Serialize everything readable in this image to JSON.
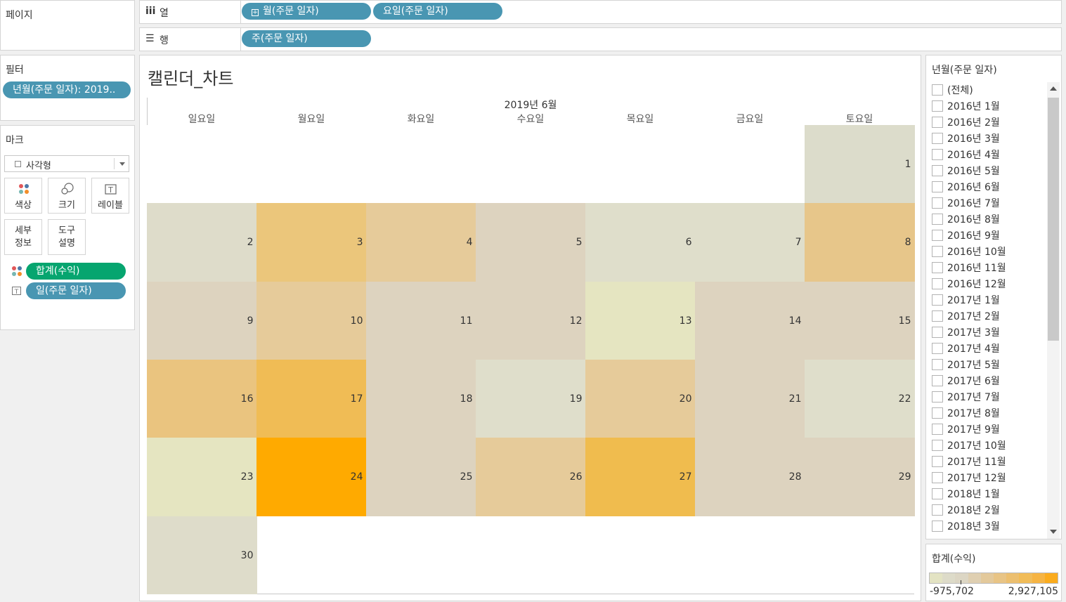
{
  "pages_panel": {
    "title": "페이지"
  },
  "columns_shelf": {
    "label": "열",
    "pills": [
      "월(주문 일자)",
      "요일(주문 일자)"
    ]
  },
  "rows_shelf": {
    "label": "행",
    "pills": [
      "주(주문 일자)"
    ]
  },
  "filters_panel": {
    "title": "필터",
    "pill": "년월(주문 일자): 2019.."
  },
  "marks_panel": {
    "title": "마크",
    "mark_type": "사각형",
    "buttons": {
      "color": "색상",
      "size": "크기",
      "label": "레이블",
      "detail": "세부\n정보",
      "tooltip": "도구\n설명"
    },
    "color_pill": "합계(수익)",
    "label_pill": "일(주문 일자)"
  },
  "chart": {
    "sheet_title": "캘린더_차트",
    "month_header": "2019년 6월",
    "weekdays": [
      "일요일",
      "월요일",
      "화요일",
      "수요일",
      "목요일",
      "금요일",
      "토요일"
    ]
  },
  "chart_data": {
    "type": "heatmap",
    "title": "캘린더_차트",
    "month": "2019년 6월",
    "columns": [
      "일요일",
      "월요일",
      "화요일",
      "수요일",
      "목요일",
      "금요일",
      "토요일"
    ],
    "cells": [
      {
        "day": 1,
        "week": 0,
        "weekday": 6,
        "color": "#dcdccb"
      },
      {
        "day": 2,
        "week": 1,
        "weekday": 0,
        "color": "#dedcca"
      },
      {
        "day": 3,
        "week": 1,
        "weekday": 1,
        "color": "#ebc67b"
      },
      {
        "day": 4,
        "week": 1,
        "weekday": 2,
        "color": "#e6cb9a"
      },
      {
        "day": 5,
        "week": 1,
        "weekday": 3,
        "color": "#ddd3bf"
      },
      {
        "day": 6,
        "week": 1,
        "weekday": 4,
        "color": "#dfdecb"
      },
      {
        "day": 7,
        "week": 1,
        "weekday": 5,
        "color": "#dfdecb"
      },
      {
        "day": 8,
        "week": 1,
        "weekday": 6,
        "color": "#e7c68a"
      },
      {
        "day": 9,
        "week": 2,
        "weekday": 0,
        "color": "#ddd3bf"
      },
      {
        "day": 10,
        "week": 2,
        "weekday": 1,
        "color": "#e6cb9a"
      },
      {
        "day": 11,
        "week": 2,
        "weekday": 2,
        "color": "#ddd3bf"
      },
      {
        "day": 12,
        "week": 2,
        "weekday": 3,
        "color": "#ddd3bf"
      },
      {
        "day": 13,
        "week": 2,
        "weekday": 4,
        "color": "#e5e5c1"
      },
      {
        "day": 14,
        "week": 2,
        "weekday": 5,
        "color": "#ddd3bf"
      },
      {
        "day": 15,
        "week": 2,
        "weekday": 6,
        "color": "#ddd3bf"
      },
      {
        "day": 16,
        "week": 3,
        "weekday": 0,
        "color": "#eac47f"
      },
      {
        "day": 17,
        "week": 3,
        "weekday": 1,
        "color": "#f0bc55"
      },
      {
        "day": 18,
        "week": 3,
        "weekday": 2,
        "color": "#ddd3bf"
      },
      {
        "day": 19,
        "week": 3,
        "weekday": 3,
        "color": "#dfdecb"
      },
      {
        "day": 20,
        "week": 3,
        "weekday": 4,
        "color": "#e6cb9a"
      },
      {
        "day": 21,
        "week": 3,
        "weekday": 5,
        "color": "#ddd3bf"
      },
      {
        "day": 22,
        "week": 3,
        "weekday": 6,
        "color": "#dfdecb"
      },
      {
        "day": 23,
        "week": 4,
        "weekday": 0,
        "color": "#e5e5c1"
      },
      {
        "day": 24,
        "week": 4,
        "weekday": 1,
        "color": "#ffaa00"
      },
      {
        "day": 25,
        "week": 4,
        "weekday": 2,
        "color": "#ddd3bf"
      },
      {
        "day": 26,
        "week": 4,
        "weekday": 3,
        "color": "#e6cb9a"
      },
      {
        "day": 27,
        "week": 4,
        "weekday": 4,
        "color": "#f0bc4e"
      },
      {
        "day": 28,
        "week": 4,
        "weekday": 5,
        "color": "#ddd3bf"
      },
      {
        "day": 29,
        "week": 4,
        "weekday": 6,
        "color": "#ddd3bf"
      },
      {
        "day": 30,
        "week": 5,
        "weekday": 0,
        "color": "#dedcca"
      }
    ]
  },
  "filter_list": {
    "title": "년월(주문 일자)",
    "items": [
      "(전체)",
      "2016년 1월",
      "2016년 2월",
      "2016년 3월",
      "2016년 4월",
      "2016년 5월",
      "2016년 6월",
      "2016년 7월",
      "2016년 8월",
      "2016년 9월",
      "2016년 10월",
      "2016년 11월",
      "2016년 12월",
      "2017년 1월",
      "2017년 2월",
      "2017년 3월",
      "2017년 4월",
      "2017년 5월",
      "2017년 6월",
      "2017년 7월",
      "2017년 8월",
      "2017년 9월",
      "2017년 10월",
      "2017년 11월",
      "2017년 12월",
      "2018년 1월",
      "2018년 2월",
      "2018년 3월"
    ]
  },
  "legend": {
    "title": "합계(수익)",
    "min_label": "-975,702",
    "max_label": "2,927,105",
    "colors": [
      "#e3e3c3",
      "#dddbc9",
      "#dcd6c4",
      "#dfcfb1",
      "#e3c99b",
      "#e8c485",
      "#ecbf6f",
      "#f1bc58",
      "#f6b443",
      "#fbac1e"
    ]
  }
}
